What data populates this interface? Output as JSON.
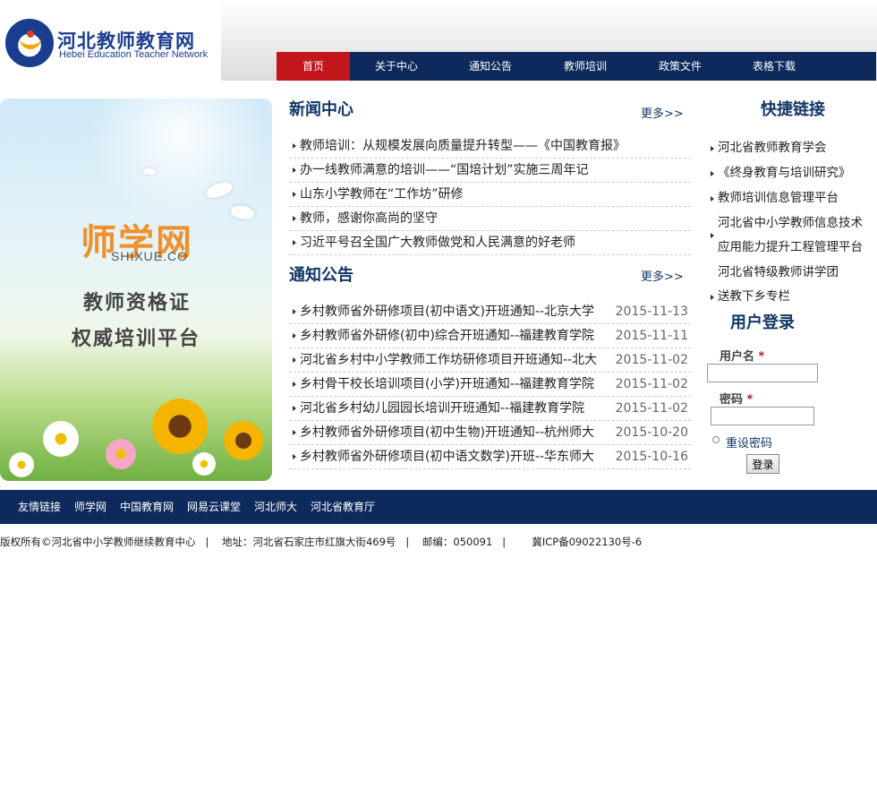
{
  "header": {
    "logo_cn": "河北教师教育网",
    "logo_en": "Hebei Education Teacher Network"
  },
  "nav": [
    {
      "label": "首页",
      "active": true
    },
    {
      "label": "关于中心"
    },
    {
      "label": "通知公告"
    },
    {
      "label": "教师培训"
    },
    {
      "label": "政策文件"
    },
    {
      "label": "表格下载"
    }
  ],
  "banner": {
    "brand": "师学网",
    "brand_sub": "SHIXUE.CO",
    "line1": "教师资格证",
    "line2": "权威培训平台"
  },
  "news": {
    "title": "新闻中心",
    "more": "更多>>",
    "items": [
      "教师培训：从规模发展向质量提升转型——《中国教育报》",
      "办一线教师满意的培训——“国培计划”实施三周年记",
      "山东小学教师在“工作坊”研修",
      "教师，感谢你高尚的坚守",
      "习近平号召全国广大教师做党和人民满意的好老师"
    ]
  },
  "notices": {
    "title": "通知公告",
    "more": "更多>>",
    "items": [
      {
        "text": "乡村教师省外研修项目(初中语文)开班通知--北京大学",
        "date": "2015-11-13"
      },
      {
        "text": "乡村教师省外研修(初中)综合开班通知--福建教育学院",
        "date": "2015-11-11"
      },
      {
        "text": "河北省乡村中小学教师工作坊研修项目开班通知--北大",
        "date": "2015-11-02"
      },
      {
        "text": "乡村骨干校长培训项目(小学)开班通知--福建教育学院",
        "date": "2015-11-02"
      },
      {
        "text": "河北省乡村幼儿园园长培训开班通知--福建教育学院",
        "date": "2015-11-02"
      },
      {
        "text": "乡村教师省外研修项目(初中生物)开班通知--杭州师大",
        "date": "2015-10-20"
      },
      {
        "text": "乡村教师省外研修项目(初中语文数学)开班--华东师大",
        "date": "2015-10-16"
      }
    ]
  },
  "quicklinks": {
    "title": "快捷链接",
    "items": [
      "河北省教师教育学会",
      "《终身教育与培训研究》",
      "教师培训信息管理平台",
      "河北省中小学教师信息技术应用能力提升工程管理平台",
      "河北省特级教师讲学团送教下乡专栏"
    ]
  },
  "login": {
    "title": "用户登录",
    "username_label": "用户名",
    "password_label": "密码",
    "required_mark": "*",
    "reset_label": "重设密码",
    "submit_label": "登录"
  },
  "friend_links": {
    "items": [
      "友情链接",
      "师学网",
      "中国教育网",
      "网易云课堂",
      "河北师大",
      "河北省教育厅"
    ]
  },
  "footer": {
    "copyright": "版权所有©河北省中小学教师继续教育中心   |    地址：河北省石家庄市红旗大街469号   |    邮编：050091   |        冀ICP备09022130号-6"
  }
}
